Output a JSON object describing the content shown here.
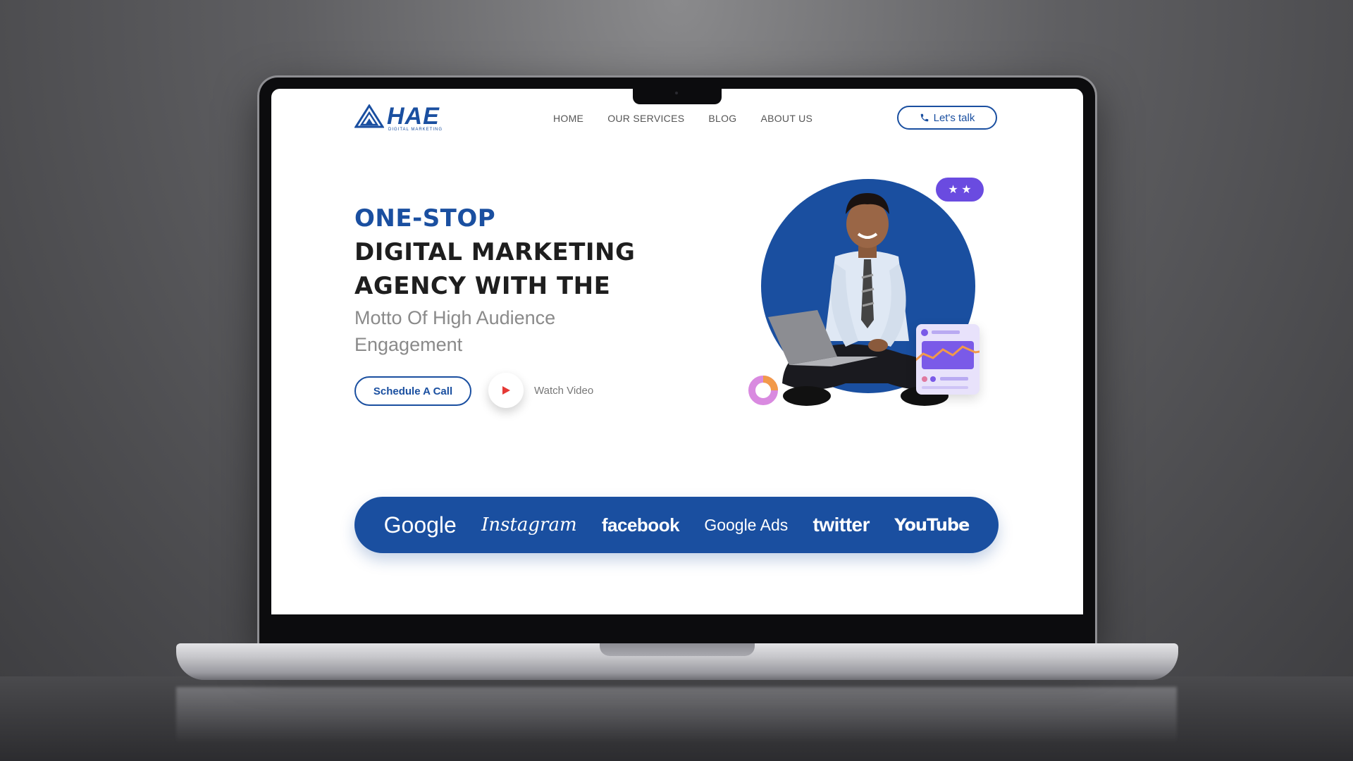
{
  "brand": {
    "name": "HAE",
    "tagline": "DIGITAL MARKETING"
  },
  "nav": {
    "items": [
      {
        "label": "HOME"
      },
      {
        "label": "OUR SERVICES"
      },
      {
        "label": "BLOG"
      },
      {
        "label": "ABOUT US"
      }
    ],
    "cta_label": "Let's talk"
  },
  "hero": {
    "title_line1": "ONE-STOP",
    "title_line2": "DIGITAL MARKETING",
    "title_line3": "AGENCY WITH THE",
    "subtitle": "Motto Of High Audience Engagement",
    "primary_button": "Schedule A Call",
    "video_label": "Watch Video",
    "stars": "★ ★"
  },
  "partners": [
    {
      "label": "Google"
    },
    {
      "label": "Instagram"
    },
    {
      "label": "facebook"
    },
    {
      "label": "Google Ads"
    },
    {
      "label": "twitter"
    },
    {
      "label": "YouTube"
    }
  ],
  "colors": {
    "primary": "#1a4fa0",
    "accent_purple": "#6a4be0",
    "play_red": "#e53935",
    "background": "#ffffff"
  },
  "icons": {
    "logo": "triangle-logo-icon",
    "cta": "phone-icon",
    "video": "play-icon",
    "rating": "star-icon"
  }
}
